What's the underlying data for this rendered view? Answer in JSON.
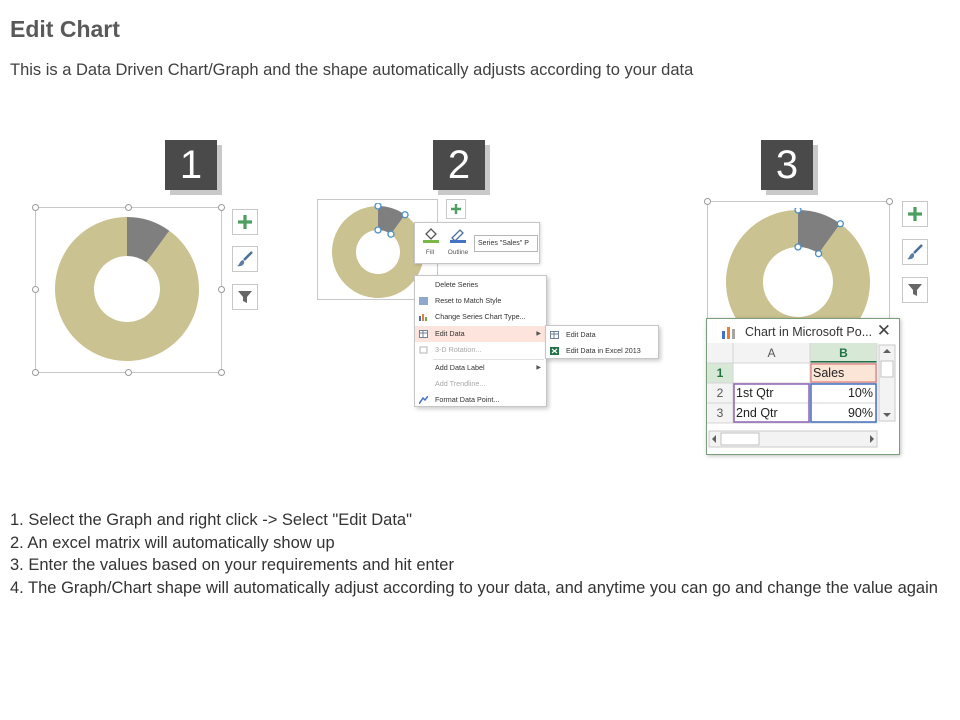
{
  "header": {
    "title": "Edit Chart",
    "subtitle": "This is a Data Driven Chart/Graph and the shape automatically adjusts according to your data"
  },
  "badges": [
    "1",
    "2",
    "3"
  ],
  "colors": {
    "donut_main": "#cbc291",
    "donut_slice": "#7f7f7f",
    "badge_bg": "#4a4a4a",
    "button_green": "#4d9e60",
    "context_highlight": "#fde4dc",
    "excel_header_selected": "#d7e8d6",
    "excel_green": "#217346"
  },
  "icons": {
    "add": "plus-icon",
    "style": "paintbrush-icon",
    "filter": "funnel-icon",
    "fill": "paint-bucket-icon",
    "outline": "pen-outline-icon",
    "close": "close-icon"
  },
  "panel2": {
    "fill_label": "Fill",
    "outline_label": "Outline",
    "series_value": "Series \"Sales\" P",
    "context_menu": [
      {
        "label": "Delete Series",
        "enabled": true
      },
      {
        "label": "Reset to Match Style",
        "enabled": true
      },
      {
        "label": "Change Series Chart Type...",
        "enabled": true
      },
      {
        "label": "Edit Data",
        "enabled": true,
        "submenu": true
      },
      {
        "label": "3-D Rotation...",
        "enabled": false
      },
      {
        "label": "Add Data Label",
        "enabled": true,
        "submenu": true
      },
      {
        "label": "Add Trendline...",
        "enabled": false
      },
      {
        "label": "Format Data Point...",
        "enabled": true
      }
    ],
    "submenu": [
      "Edit Data",
      "Edit Data in Excel 2013"
    ]
  },
  "excel": {
    "window_title": "Chart in Microsoft Po...",
    "columns": [
      "A",
      "B"
    ],
    "row_numbers": [
      "1",
      "2",
      "3"
    ],
    "rows": [
      [
        "",
        "Sales"
      ],
      [
        "1st Qtr",
        "10%"
      ],
      [
        "2nd Qtr",
        "90%"
      ]
    ]
  },
  "chart_data": {
    "type": "pie",
    "categories": [
      "1st Qtr",
      "2nd Qtr"
    ],
    "series": [
      {
        "name": "Sales",
        "values": [
          10,
          90
        ]
      }
    ],
    "unit": "%"
  },
  "steps": [
    "1. Select the Graph and right click -> Select \"Edit Data\"",
    "2. An excel matrix will automatically show up",
    "3. Enter the values based on your requirements and hit enter",
    "4. The Graph/Chart shape will automatically adjust according to your data, and anytime you can go and change the value again"
  ]
}
